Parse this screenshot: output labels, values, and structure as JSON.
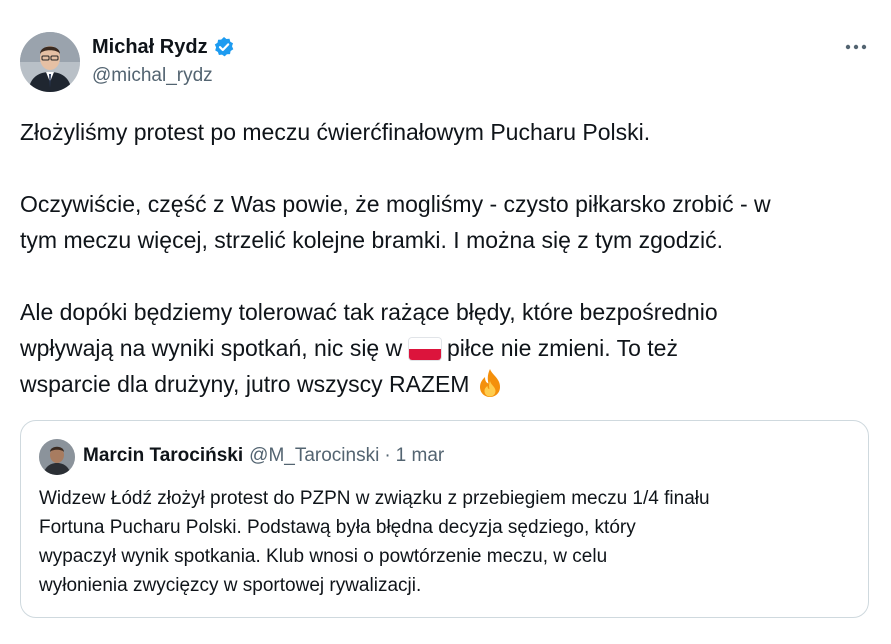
{
  "author": {
    "name": "Michał Rydz",
    "handle": "@michal_rydz",
    "verified": true
  },
  "tweet": {
    "line1": "Złożyliśmy protest po meczu ćwierćfinałowym Pucharu Polski.",
    "line2a": "Oczywiście, część z Was powie, że mogliśmy - czysto piłkarsko zrobić - w",
    "line2b": "tym meczu więcej, strzelić kolejne bramki. I można się z tym zgodzić.",
    "line3a": "Ale dopóki będziemy tolerować tak rażące błędy, które bezpośrednio",
    "line3b_pre": "wpływają na wyniki spotkań, nic się w",
    "line3b_post": "piłce nie zmieni. To też",
    "line3c": "wsparcie dla drużyny, jutro wszyscy RAZEM",
    "emoji_flag": "poland-flag-icon",
    "emoji_fire": "fire-icon"
  },
  "quoted": {
    "name": "Marcin Tarociński",
    "handle": "@M_Tarocinski",
    "separator": "·",
    "date": "1 mar",
    "line1": "Widzew Łódź złożył protest do PZPN w związku z przebiegiem meczu 1/4 finału",
    "line2": "Fortuna Pucharu Polski. Podstawą była błędna decyzja sędziego, który",
    "line3": "wypaczył wynik spotkania. Klub wnosi o powtórzenie meczu, w celu",
    "line4": "wyłonienia zwycięzcy w sportowej rywalizacji."
  },
  "colors": {
    "verified_blue": "#1d9bf0",
    "secondary_text": "#536471",
    "border": "#cfd9de"
  }
}
